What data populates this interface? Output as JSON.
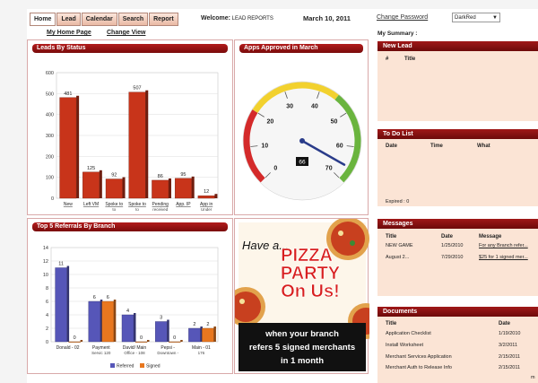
{
  "nav": {
    "tabs": [
      "Home",
      "Lead",
      "Calendar",
      "Search",
      "Report"
    ],
    "welcome_label": "Welcome:",
    "welcome_user": "LEAD REPORTS",
    "date": "March 10, 2011",
    "change_password": "Change Password",
    "theme": "DarkRed"
  },
  "subnav": {
    "home": "My Home Page",
    "change_view": "Change View"
  },
  "summary_label": "My Summary :",
  "panels": {
    "leads_by_status": "Leads By Status",
    "apps_approved": "Apps Approved in March",
    "top_referrals": "Top 5 Referrals By Branch"
  },
  "gauge": {
    "value": 66,
    "min": 0,
    "max": 70,
    "ticks": [
      0,
      10,
      20,
      30,
      40,
      50,
      60,
      70
    ]
  },
  "chart_data": [
    {
      "type": "bar",
      "title": "Leads By Status",
      "categories": [
        "New",
        "Left VM",
        "Spoke to",
        "Spoke to",
        "Pending",
        "App. IP",
        "App in"
      ],
      "category_sublabels": [
        "",
        "",
        "to",
        "to",
        "received",
        "",
        "Under"
      ],
      "values": [
        481,
        125,
        92,
        507,
        86,
        95,
        12
      ],
      "ylim": [
        0,
        600
      ],
      "yticks": [
        0,
        100,
        200,
        300,
        400,
        500,
        600
      ],
      "color": "#c8341a"
    },
    {
      "type": "bar",
      "title": "Top 5 Referrals By Branch",
      "categories": [
        "Donald - 02",
        "Payment",
        "David/ Main",
        "Pepsi -",
        "Main - 01"
      ],
      "category_sublabels": [
        "",
        "Servic 120",
        "Office - 108",
        "Downtown -",
        "176"
      ],
      "series": [
        {
          "name": "Referred",
          "values": [
            11,
            6,
            4,
            3,
            2
          ],
          "color": "#5656b8"
        },
        {
          "name": "Signed",
          "values": [
            0,
            6,
            0,
            0,
            2
          ],
          "color": "#e8771f"
        }
      ],
      "ylim": [
        0,
        14
      ],
      "yticks": [
        0,
        2,
        4,
        6,
        8,
        10,
        12,
        14
      ]
    }
  ],
  "promo": {
    "line1": "Have a...",
    "line2": "PIZZA",
    "line3": "PARTY",
    "line4": "On Us!",
    "body1": "when your branch",
    "body2": "refers 5 signed merchants",
    "body3": "in 1 month"
  },
  "new_lead": {
    "title": "New Lead",
    "cols": [
      "#",
      "Title"
    ]
  },
  "todo": {
    "title": "To Do List",
    "cols": [
      "Date",
      "Time",
      "What"
    ],
    "footer": "Expired : 0"
  },
  "messages": {
    "title": "Messages",
    "cols": [
      "Title",
      "Date",
      "Message"
    ],
    "rows": [
      {
        "title": "NEW GAME",
        "date": "1/25/2010",
        "message": "For any Branch refer..."
      },
      {
        "title": "August 2...",
        "date": "7/29/2010",
        "message": "$25 for 1 signed mer..."
      }
    ]
  },
  "documents": {
    "title": "Documents",
    "cols": [
      "Title",
      "Date"
    ],
    "rows": [
      {
        "title": "Application Checklist",
        "date": "1/19/2010"
      },
      {
        "title": "Install Worksheet",
        "date": "3/2/2011"
      },
      {
        "title": "Merchant Services Application",
        "date": "2/15/2011"
      },
      {
        "title": "Merchant Auth to Release Info",
        "date": "2/15/2011"
      }
    ],
    "more": "m"
  }
}
